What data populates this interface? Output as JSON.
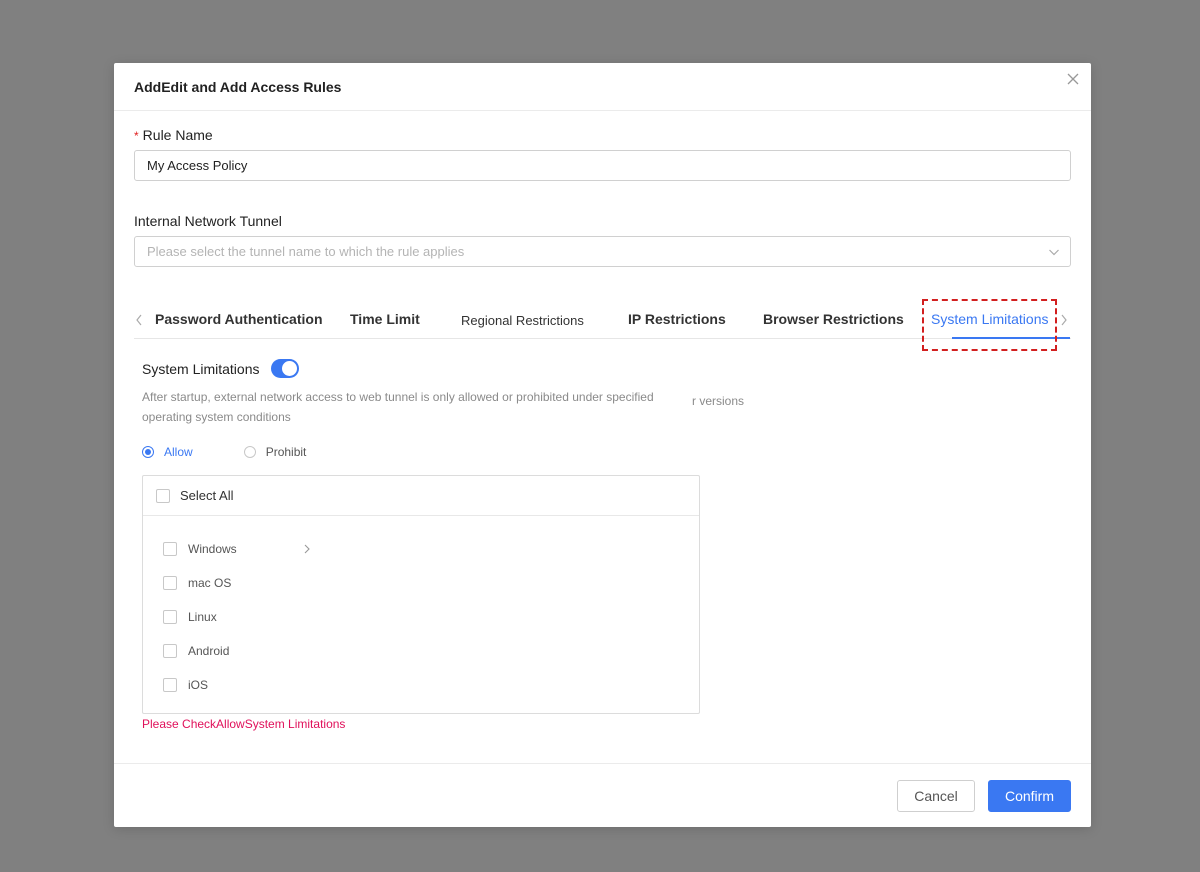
{
  "dialog": {
    "title": "AddEdit and Add Access Rules"
  },
  "rule_name": {
    "required_mark": "*",
    "label": "Rule Name",
    "value": "My Access Policy"
  },
  "tunnel": {
    "label": "Internal Network Tunnel",
    "placeholder": "Please select the tunnel name to which the rule applies"
  },
  "tabs": [
    {
      "label": "Password Authentication"
    },
    {
      "label": "Time Limit"
    },
    {
      "label": "Regional Restrictions"
    },
    {
      "label": "IP Restrictions"
    },
    {
      "label": "Browser Restrictions"
    },
    {
      "label": "System Limitations"
    }
  ],
  "active_tab": "System Limitations",
  "system_limitations": {
    "label": "System Limitations",
    "enabled": true,
    "hint": "After startup, external network access to web tunnel is only allowed or prohibited under specified operating system conditions",
    "hint_overflow": "r versions",
    "mode_options": [
      "Allow",
      "Prohibit"
    ],
    "selected_mode": "Allow",
    "select_all_label": "Select All",
    "os_options": [
      {
        "label": "Windows",
        "checked": false
      },
      {
        "label": "mac OS",
        "checked": false
      },
      {
        "label": "Linux",
        "checked": false
      },
      {
        "label": "Android",
        "checked": false
      },
      {
        "label": "iOS",
        "checked": false
      }
    ],
    "error": "Please CheckAllowSystem Limitations"
  },
  "footer": {
    "cancel_label": "Cancel",
    "confirm_label": "Confirm"
  },
  "colors": {
    "primary": "#3a78f2",
    "error": "#e0105a",
    "highlight": "#d21f1f"
  }
}
